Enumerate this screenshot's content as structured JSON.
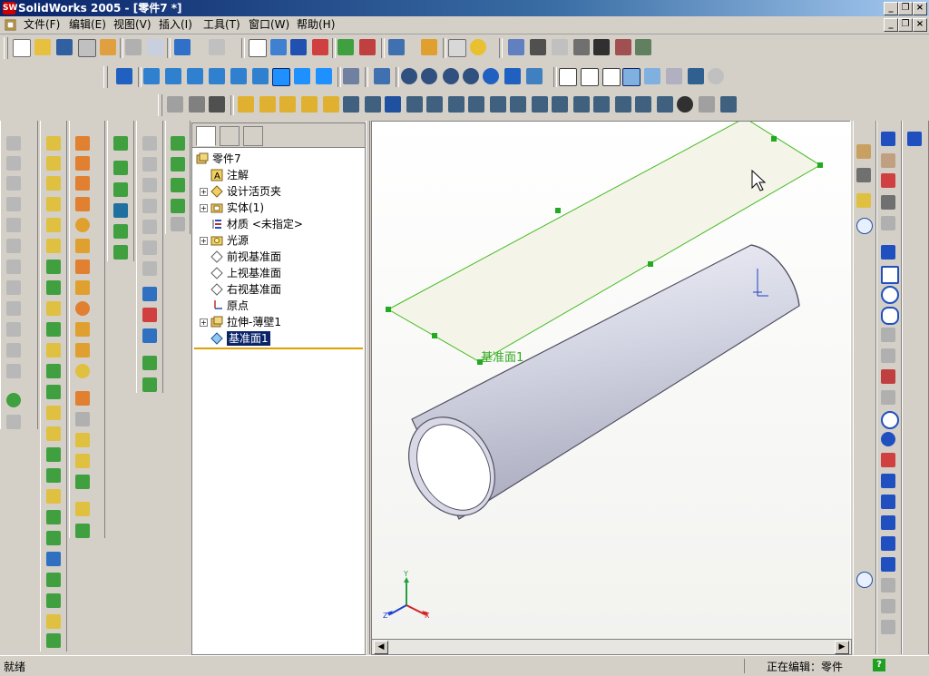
{
  "window": {
    "title": "SolidWorks 2005 - [零件7 *]",
    "logo": "SW"
  },
  "menu": {
    "items": [
      "文件(F)",
      "编辑(E)",
      "视图(V)",
      "插入(I)",
      "工具(T)",
      "窗口(W)",
      "帮助(H)"
    ]
  },
  "tree": {
    "root": "零件7",
    "items": [
      "注解",
      "设计活页夹",
      "实体(1)",
      "材质 <未指定>",
      "光源",
      "前视基准面",
      "上视基准面",
      "右视基准面",
      "原点",
      "拉伸-薄壁1",
      "基准面1"
    ]
  },
  "viewport": {
    "plane_label": "基准面1",
    "triad": {
      "x": "X",
      "y": "Y",
      "z": "Z"
    }
  },
  "status": {
    "left": "就绪",
    "editing": "正在编辑：零件",
    "help": "?"
  },
  "colors": {
    "plane_edge": "#44bb22",
    "handle": "#22aa22",
    "selection": "#0a246a",
    "tube": "#d9dae6"
  }
}
